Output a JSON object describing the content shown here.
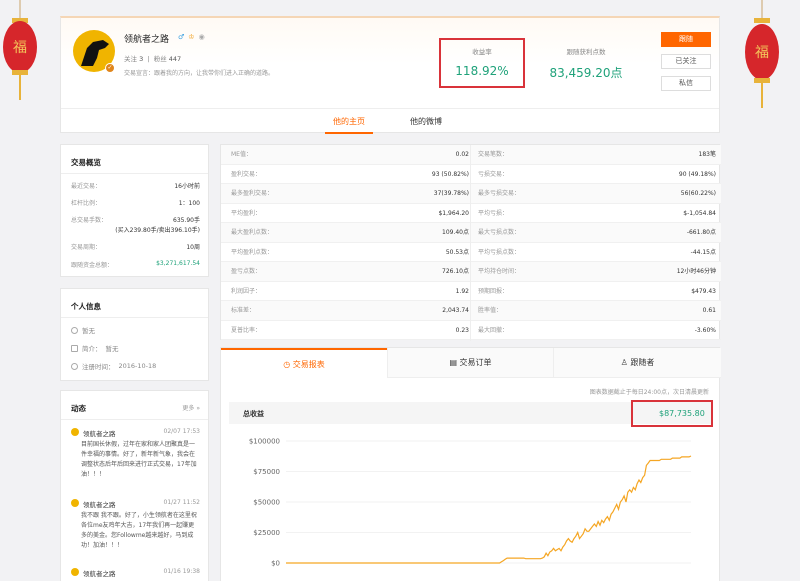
{
  "profile": {
    "name": "领航者之路",
    "gender_icon": "male-icon",
    "follow_label": "关注",
    "follow_count": "3",
    "fans_label": "粉丝",
    "fans_count": "447",
    "intro": "交易宣言：跟着我的方向，让我带你们进入正确的道路。",
    "return_label": "收益率",
    "return_value": "118.92%",
    "points_label": "跟随获利点数",
    "points_value": "83,459.20点",
    "buttons": {
      "follow": "跟随",
      "followed": "已关注",
      "message": "私信"
    }
  },
  "tabs_top": [
    "他的主页",
    "他的微博"
  ],
  "overview": {
    "title": "交易概览",
    "rows": [
      {
        "k": "最近交易：",
        "v": "16小时前"
      },
      {
        "k": "杠杆比例：",
        "v": "1：100"
      },
      {
        "k": "总交易手数：",
        "v": "635.90手"
      },
      {
        "k": "",
        "v": "(买入239.80手/卖出396.10手)"
      },
      {
        "k": "交易周期：",
        "v": "10周"
      },
      {
        "k": "跟随资金总额：",
        "v": "$3,271,617.54"
      }
    ]
  },
  "personal": {
    "title": "个人信息",
    "location": "暂无",
    "bio_label": "简介：",
    "bio": "暂无",
    "reg_label": "注册时间：",
    "reg_date": "2016-10-18"
  },
  "news": {
    "title": "动态",
    "more": "更多 »",
    "items": [
      {
        "name": "领航者之路",
        "time": "02/07 17:53",
        "text": "目前国长休假，过年在家和家人团聚真是一件幸福的事情。好了，新年新气象，我会在调整状态后年后回来进行正式交易，17年加油！！！"
      },
      {
        "name": "领航者之路",
        "time": "01/27 11:52",
        "text": "我不跟 我不跟。好了，小生领航者在这里祝各位me友鸡年大吉，17年我们再一起赚更多的美金。您Followme越来越好，马到成功！加油！！！"
      },
      {
        "name": "领航者之路",
        "time": "01/16 19:38",
        "text": ""
      }
    ]
  },
  "metrics": {
    "left": [
      {
        "k": "ME值：",
        "v": "0.02"
      },
      {
        "k": "盈利交易：",
        "v": "93 (50.82%)"
      },
      {
        "k": "最多盈利交易：",
        "v": "37(39.78%)"
      },
      {
        "k": "平均盈利：",
        "v": "$1,964.20"
      },
      {
        "k": "最大盈利点数：",
        "v": "109.40点"
      },
      {
        "k": "平均盈利点数：",
        "v": "50.53点"
      },
      {
        "k": "盈亏点数：",
        "v": "726.10点"
      },
      {
        "k": "利润因子：",
        "v": "1.92"
      },
      {
        "k": "标准差：",
        "v": "2,043.74"
      },
      {
        "k": "夏普比率：",
        "v": "0.23"
      }
    ],
    "right": [
      {
        "k": "交易笔数：",
        "v": "183笔"
      },
      {
        "k": "亏损交易：",
        "v": "90 (49.18%)"
      },
      {
        "k": "最多亏损交易：",
        "v": "56(60.22%)"
      },
      {
        "k": "平均亏损：",
        "v": "$-1,054.84"
      },
      {
        "k": "最大亏损点数：",
        "v": "-661.80点"
      },
      {
        "k": "平均亏损点数：",
        "v": "-44.15点"
      },
      {
        "k": "平均持仓时间：",
        "v": "12小时46分钟"
      },
      {
        "k": "预期回报：",
        "v": "$479.43"
      },
      {
        "k": "胜率值：",
        "v": "0.61"
      },
      {
        "k": "最大回撤：",
        "v": "-3.60%"
      }
    ]
  },
  "chart_tabs": [
    "交易报表",
    "交易订单",
    "跟随者"
  ],
  "chart_note": "图表数据截止于每日24:00点，次日清晨更新",
  "total_label": "总收益",
  "total_value": "$87,735.80",
  "colors": {
    "accent": "#ff6600",
    "green": "#1fa27a",
    "line": "#f5a623",
    "highlight": "#d9333a"
  },
  "chart_data": {
    "type": "line",
    "title": "总收益",
    "ylim": [
      0,
      100000
    ],
    "yticks": [
      "$0",
      "$25000",
      "$50000",
      "$75000",
      "$100000"
    ],
    "grid": true,
    "series": [
      {
        "values": [
          0,
          0,
          0,
          0,
          0,
          0,
          0,
          0,
          0,
          0,
          0,
          0,
          0,
          0,
          0,
          0,
          0,
          0,
          0,
          0,
          0,
          0,
          0,
          0,
          0,
          0,
          0,
          0,
          0,
          0,
          0,
          0,
          0,
          0,
          0,
          0,
          0,
          0,
          0,
          0,
          0,
          0,
          0,
          0,
          0,
          0,
          0,
          0,
          0,
          0,
          0,
          0,
          0,
          0,
          0,
          0,
          0,
          0,
          0,
          0,
          0,
          0,
          0,
          0,
          0,
          0,
          0,
          0,
          0,
          0,
          0,
          0,
          0,
          0,
          0,
          0,
          0,
          0,
          0,
          0,
          0,
          0,
          0,
          0,
          0,
          0,
          0,
          0,
          0,
          0,
          0,
          0,
          0,
          0,
          0,
          0,
          0,
          0,
          0,
          0,
          0,
          0,
          0,
          0,
          0,
          0,
          0,
          0,
          0,
          0,
          0,
          0,
          0,
          0,
          0,
          0,
          1000,
          2000,
          3000,
          4000,
          4000,
          4000,
          4000,
          4000,
          4000,
          4000,
          4000,
          4000,
          4000,
          3500,
          3500,
          3500,
          3500,
          3500,
          3500,
          3500,
          3500,
          3500,
          4000,
          5000,
          8000,
          6000,
          9000,
          10000,
          12000,
          10000,
          11000,
          12000,
          10000,
          13000,
          15000,
          18000,
          20000,
          18000,
          17000,
          20000,
          22000,
          25000,
          20000,
          22000,
          24000,
          28000,
          26000,
          26000,
          28000,
          30000,
          32000,
          30000,
          34000,
          31000,
          35000,
          33000,
          36000,
          38000,
          35000,
          40000,
          42000,
          45000,
          48000,
          44000,
          50000,
          52000,
          55000,
          50000,
          58000,
          60000,
          58000,
          62000,
          60000,
          65000,
          68000,
          66000,
          70000,
          72000,
          80000,
          82000,
          84000,
          84000,
          84000,
          84000,
          84000,
          84000,
          85000,
          85000,
          85000,
          85000,
          85000,
          85000,
          86000,
          86000,
          86000,
          86000,
          86000,
          87000,
          87000,
          87000,
          87000,
          87000,
          87700
        ]
      }
    ]
  }
}
